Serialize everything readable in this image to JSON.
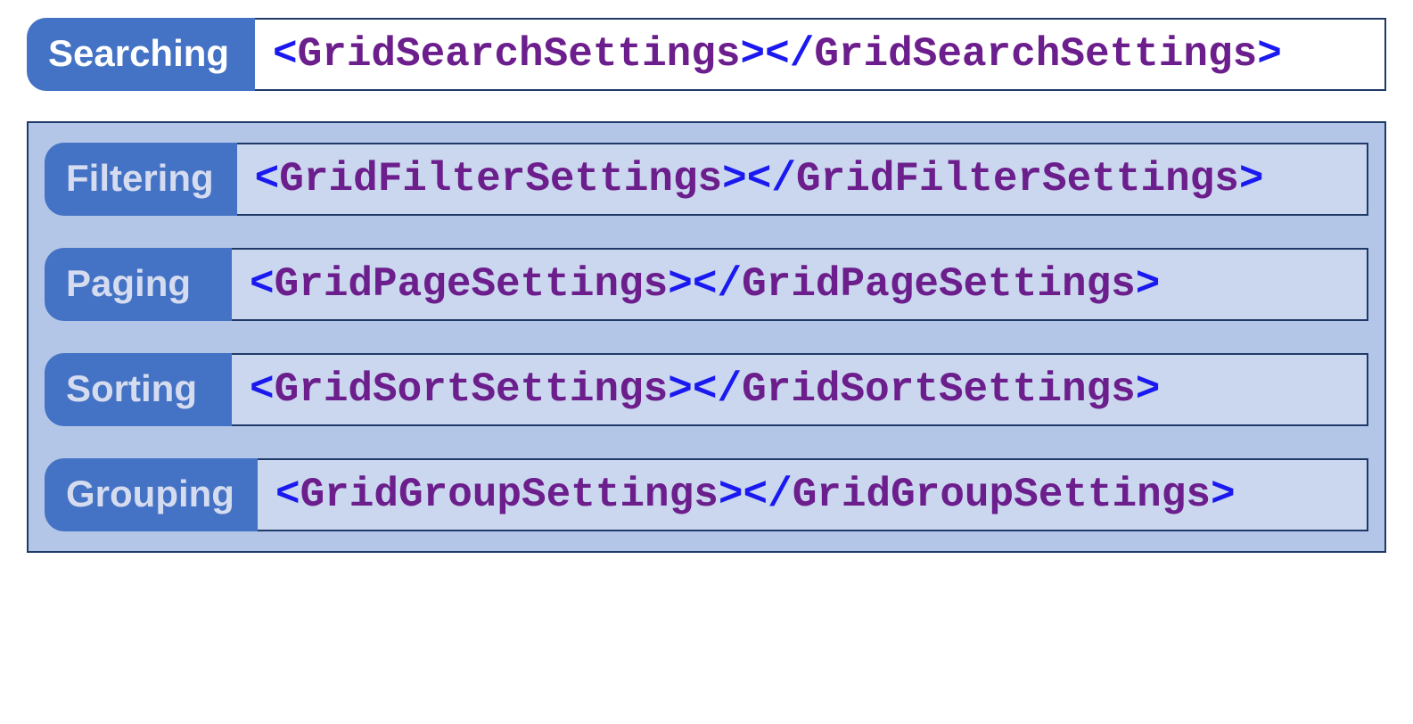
{
  "colors": {
    "label_bg": "#4472c4",
    "label_text_first": "#ffffff",
    "label_text_rest": "#d6dcf0",
    "group_bg": "#b4c6e7",
    "group_code_bg": "#cbd7ee",
    "border": "#1f3a68",
    "angle_bracket": "#1a1af0",
    "tag_name": "#6b1e8c"
  },
  "rows": [
    {
      "id": "searching",
      "label": "Searching",
      "tag": "GridSearchSettings",
      "in_group": false
    },
    {
      "id": "filtering",
      "label": "Filtering",
      "tag": "GridFilterSettings",
      "in_group": true
    },
    {
      "id": "paging",
      "label": "Paging",
      "tag": "GridPageSettings",
      "in_group": true
    },
    {
      "id": "sorting",
      "label": "Sorting",
      "tag": "GridSortSettings",
      "in_group": true
    },
    {
      "id": "grouping",
      "label": "Grouping",
      "tag": "GridGroupSettings",
      "in_group": true
    }
  ]
}
